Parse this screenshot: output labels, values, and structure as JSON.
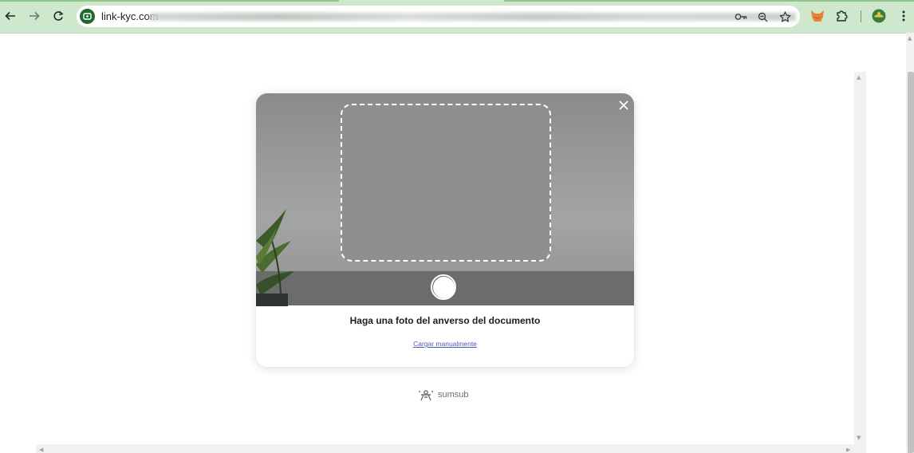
{
  "browser": {
    "url_host": "link-kyc.com",
    "icons": {
      "back": "back-arrow-icon",
      "forward": "forward-arrow-icon",
      "reload": "reload-icon",
      "site": "site-info-icon",
      "passwords": "key-icon",
      "zoom": "zoom-icon",
      "bookmark": "star-icon",
      "extension1": "extension-fox-icon",
      "extensions": "puzzle-icon",
      "profile": "profile-avatar-icon",
      "menu": "kebab-menu-icon"
    },
    "accent": "#cfe7cd"
  },
  "dialog": {
    "prompt": "Haga una foto del anverso del documento",
    "manual_link": "Cargar manualmente",
    "close_icon": "close-icon",
    "shutter_icon": "shutter-button-icon"
  },
  "footer": {
    "brand_name": "sumsub",
    "brand_icon": "sumsub-logo-icon"
  }
}
